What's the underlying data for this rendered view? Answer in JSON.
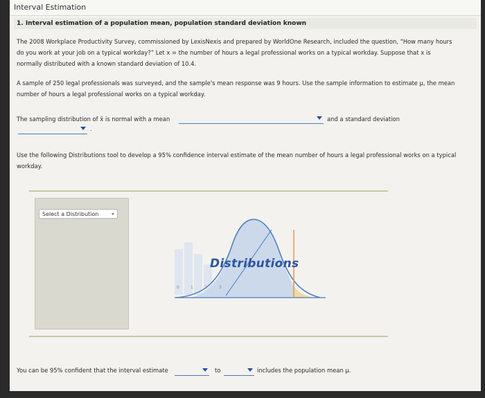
{
  "window": {
    "title": "Interval Estimation"
  },
  "question": {
    "title": "1. Interval estimation of a population mean, population standard deviation known",
    "para1_line1": "The 2008 Workplace Productivity Survey, commissioned by LexisNexis and prepared by WorldOne Research, included the question, “How many hours",
    "para1_line2": "do you work at your job on a typical workday?” Let x = the number of hours a legal professional works on a typical workday. Suppose that x is",
    "para1_line3": "normally distributed with a known standard deviation of 10.4.",
    "para2_line1": "A sample of 250 legal professionals was surveyed, and the sample's mean response was 9 hours. Use the sample information to estimate μ, the mean",
    "para2_line2": "number of hours a legal professional works on a typical workday.",
    "sampling_prefix": "The sampling distribution of x̄ is normal with a mean",
    "sampling_middle": "and a standard deviation",
    "sampling_suffix": ".",
    "tool_line1": "Use the following Distributions tool to develop a 95% confidence interval estimate of the mean number of hours a legal professional works on a typical",
    "tool_line2": "workday.",
    "answer_prefix": "You can be 95% confident that the interval estimate",
    "answer_to": "to",
    "answer_suffix": "includes the population mean μ."
  },
  "tool": {
    "select_label": "Select a Distribution",
    "logo_text": "Distributions",
    "ticks": [
      "0",
      "1",
      "2",
      "3"
    ]
  },
  "colors": {
    "accent": "#4b7bbf",
    "curve_fill": "#c7d6ea",
    "tail_fill": "#f3d7a2"
  }
}
